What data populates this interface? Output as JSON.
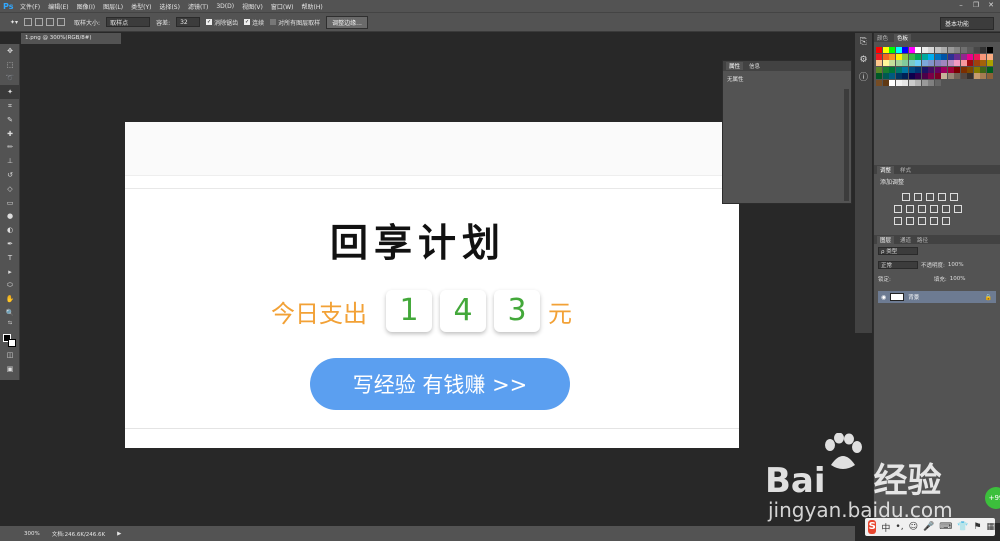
{
  "app": {
    "logo": "Ps",
    "menus": [
      "文件(F)",
      "编辑(E)",
      "图像(I)",
      "图层(L)",
      "类型(Y)",
      "选择(S)",
      "滤镜(T)",
      "3D(D)",
      "视图(V)",
      "窗口(W)",
      "帮助(H)"
    ],
    "win_controls": [
      "–",
      "❐",
      "✕"
    ]
  },
  "options": {
    "sample_size_label": "取样大小:",
    "sample_size_value": "取样点",
    "tolerance_label": "容差:",
    "tolerance_value": "32",
    "antialias_label": "消除锯齿",
    "contiguous_label": "连续",
    "all_layers_label": "对所有图层取样",
    "refine_edge_button": "调整边缘...",
    "workspace": "基本功能"
  },
  "document": {
    "tab_title": "1.png @ 300%(RGB/8#)",
    "zoom": "300%",
    "doc_size": "文档:246.6K/246.6K"
  },
  "canvas": {
    "title_art": "回享计划",
    "spend_label": "今日支出",
    "digits": [
      "1",
      "4",
      "3"
    ],
    "spend_unit": "元",
    "cta_label": "写经验 有钱赚 >>"
  },
  "properties_panel": {
    "tab_properties": "属性",
    "tab_info": "信息",
    "body": "无属性"
  },
  "swatches_panel": {
    "tab_color": "颜色",
    "tab_swatches": "色板",
    "colors": [
      "#ff0000",
      "#ffff00",
      "#00ff00",
      "#00ffff",
      "#0000ff",
      "#ff00ff",
      "#ffffff",
      "#ebebeb",
      "#d6d6d6",
      "#c2c2c2",
      "#adadad",
      "#999999",
      "#858585",
      "#707070",
      "#5c5c5c",
      "#474747",
      "#333333",
      "#000000",
      "#ed1c24",
      "#f26522",
      "#f7941d",
      "#fff200",
      "#8dc63f",
      "#39b54a",
      "#00a651",
      "#00a99d",
      "#00aeef",
      "#0072bc",
      "#0054a6",
      "#2e3192",
      "#662d91",
      "#92278f",
      "#ec008c",
      "#ed145b",
      "#f7977a",
      "#fbad82",
      "#fdc68c",
      "#fff79a",
      "#c4df9b",
      "#a3d39c",
      "#82ca9c",
      "#7accc8",
      "#6dcff6",
      "#7da7d9",
      "#8393ca",
      "#8781bd",
      "#a186be",
      "#bc8cbf",
      "#f49ac1",
      "#f6989d",
      "#9e0b0f",
      "#a0410d",
      "#a3620a",
      "#aba000",
      "#598527",
      "#1a7b30",
      "#007236",
      "#00746b",
      "#0076a3",
      "#004b80",
      "#003471",
      "#1b1464",
      "#440e62",
      "#630460",
      "#9e005d",
      "#9e0039",
      "#790000",
      "#7b2e00",
      "#7d4900",
      "#827b00",
      "#406618",
      "#005e20",
      "#005826",
      "#005952",
      "#005b7f",
      "#003663",
      "#002157",
      "#0d004c",
      "#32004b",
      "#4b0049",
      "#7b0046",
      "#7a0026",
      "#c7b299",
      "#998675",
      "#736357",
      "#534741",
      "#37302d",
      "#c69c6d",
      "#a67c52",
      "#8c6239",
      "#754c24",
      "#603913",
      "#ffffff",
      "#f2f2f2",
      "#e6e6e6",
      "#cccccc",
      "#b3b3b3",
      "#999999",
      "#808080",
      "#666666"
    ]
  },
  "adjust_panel": {
    "tab_adjust": "调整",
    "tab_styles": "样式",
    "title": "添加调整"
  },
  "layers_panel": {
    "tab_layers": "图层",
    "tab_channels": "通道",
    "tab_paths": "路径",
    "kind_label": "ρ 类型",
    "blend_mode": "正常",
    "opacity_label": "不透明度:",
    "opacity_value": "100%",
    "lock_label": "锁定:",
    "fill_label": "填充:",
    "fill_value": "100%",
    "layer_name": "背景"
  },
  "watermark": {
    "brand_left": "Bai",
    "brand_right": "经验",
    "url": "jingyan.baidu.com"
  },
  "ime": {
    "logo": "S",
    "items": [
      "中",
      "•,",
      "☺",
      "🎤",
      "⌨",
      "👕",
      "⚑",
      "▦"
    ]
  },
  "badge": "+99"
}
